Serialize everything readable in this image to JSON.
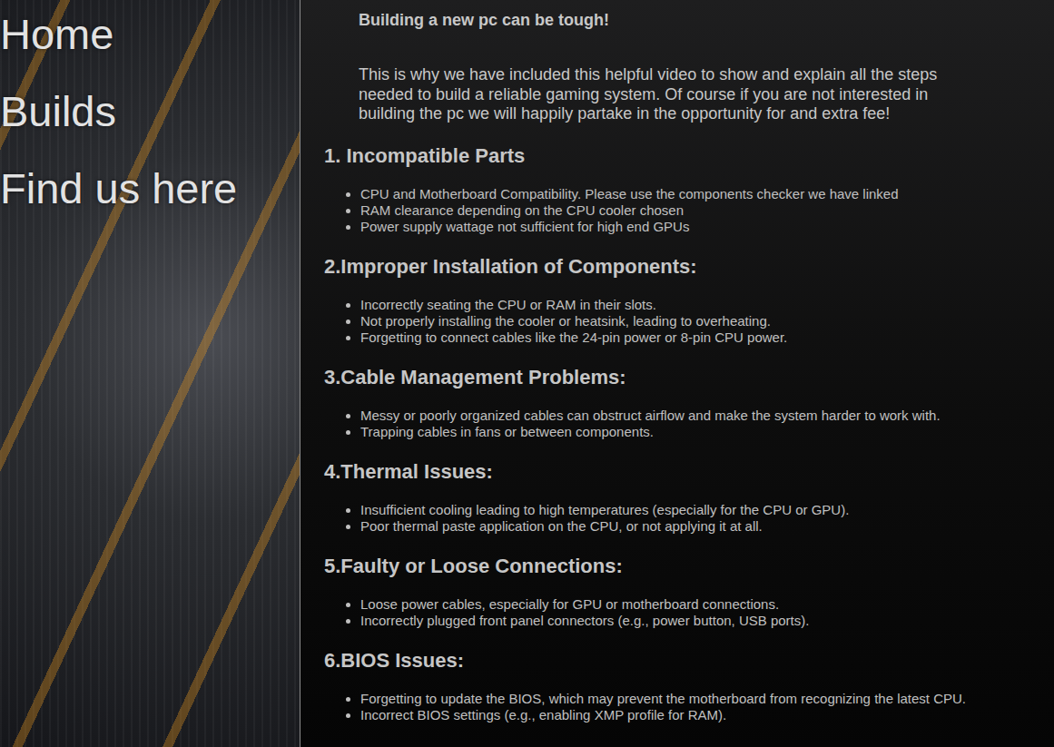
{
  "nav": [
    {
      "label": "Home"
    },
    {
      "label": "Builds"
    },
    {
      "label": "Find us here"
    }
  ],
  "intro": {
    "title": "Building a new pc can be tough!",
    "text": "This is why we have included this helpful video to show and explain all the steps needed to build a reliable gaming system. Of course if you are not interested in building the pc we will happily partake in the opportunity for and extra fee!"
  },
  "sections": [
    {
      "heading": "1. Incompatible Parts",
      "items": [
        "CPU and Motherboard Compatibility. Please use the components checker we have linked",
        "RAM clearance depending on the CPU cooler chosen",
        "Power supply wattage not sufficient for high end GPUs"
      ]
    },
    {
      "heading": "2.Improper Installation of Components:",
      "items": [
        "Incorrectly seating the CPU or RAM in their slots.",
        "Not properly installing the cooler or heatsink, leading to overheating.",
        "Forgetting to connect cables like the 24-pin power or 8-pin CPU power."
      ]
    },
    {
      "heading": "3.Cable Management Problems:",
      "items": [
        "Messy or poorly organized cables can obstruct airflow and make the system harder to work with.",
        "Trapping cables in fans or between components."
      ]
    },
    {
      "heading": "4.Thermal Issues:",
      "items": [
        "Insufficient cooling leading to high temperatures (especially for the CPU or GPU).",
        "Poor thermal paste application on the CPU, or not applying it at all."
      ]
    },
    {
      "heading": "5.Faulty or Loose Connections:",
      "items": [
        "Loose power cables, especially for GPU or motherboard connections.",
        "Incorrectly plugged front panel connectors (e.g., power button, USB ports)."
      ]
    },
    {
      "heading": "6.BIOS Issues:",
      "items": [
        "Forgetting to update the BIOS, which may prevent the motherboard from recognizing the latest CPU.",
        "Incorrect BIOS settings (e.g., enabling XMP profile for RAM)."
      ]
    }
  ]
}
